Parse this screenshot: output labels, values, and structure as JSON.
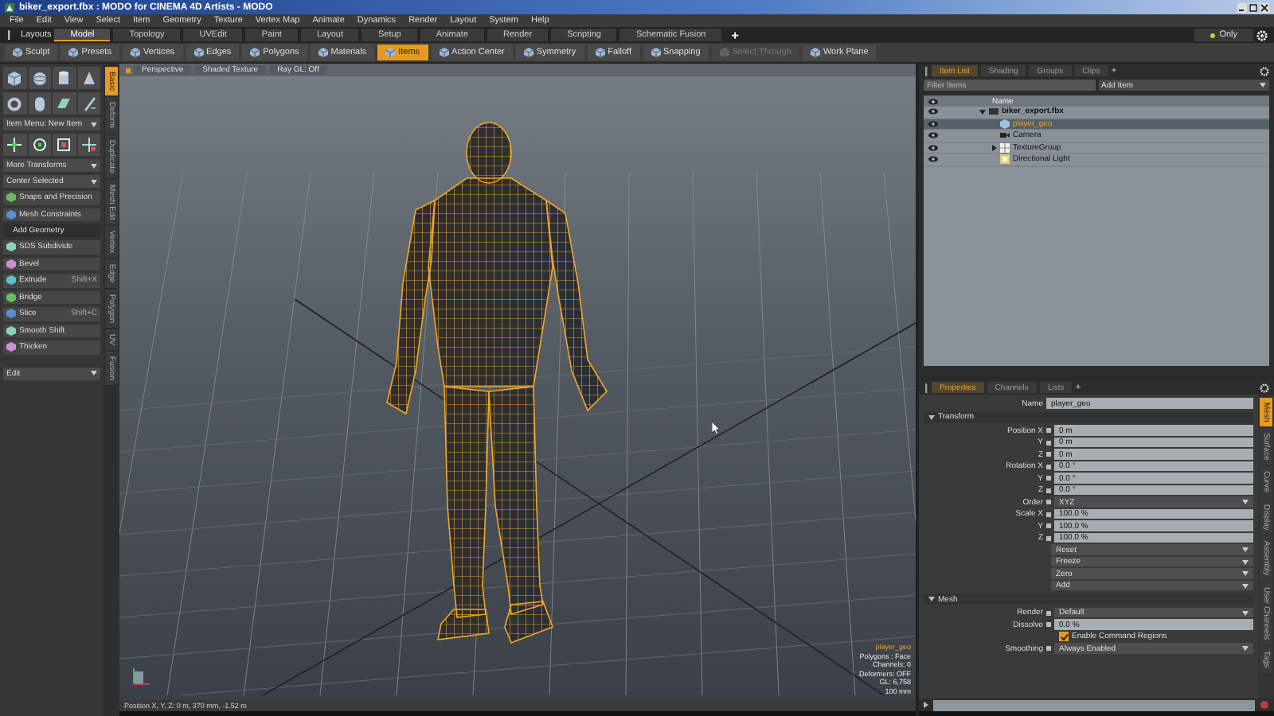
{
  "window": {
    "title": "biker_export.fbx : MODO for CINEMA 4D Artists - MODO"
  },
  "menu": [
    "File",
    "Edit",
    "View",
    "Select",
    "Item",
    "Geometry",
    "Texture",
    "Vertex Map",
    "Animate",
    "Dynamics",
    "Render",
    "Layout",
    "System",
    "Help"
  ],
  "layouts_bar": {
    "label": "Layouts",
    "tabs": [
      {
        "label": "Model",
        "selected": true
      },
      {
        "label": "Topology",
        "selected": false
      },
      {
        "label": "UVEdit",
        "selected": false
      },
      {
        "label": "Paint",
        "selected": false
      },
      {
        "label": "Layout",
        "selected": false
      },
      {
        "label": "Setup",
        "selected": false
      },
      {
        "label": "Animate",
        "selected": false
      },
      {
        "label": "Render",
        "selected": false
      },
      {
        "label": "Scripting",
        "selected": false
      },
      {
        "label": "Schematic Fusion",
        "selected": false
      }
    ],
    "add": "+",
    "filter": "Only"
  },
  "toolbar": [
    {
      "label": "Sculpt",
      "selected": false,
      "disabled": false
    },
    {
      "label": "Presets",
      "selected": false,
      "disabled": false
    },
    {
      "label": "Vertices",
      "selected": false,
      "disabled": false
    },
    {
      "label": "Edges",
      "selected": false,
      "disabled": false
    },
    {
      "label": "Polygons",
      "selected": false,
      "disabled": false
    },
    {
      "label": "Materials",
      "selected": false,
      "disabled": false
    },
    {
      "label": "Items",
      "selected": true,
      "disabled": false
    },
    {
      "label": "Action Center",
      "selected": false,
      "disabled": false
    },
    {
      "label": "Symmetry",
      "selected": false,
      "disabled": false
    },
    {
      "label": "Falloff",
      "selected": false,
      "disabled": false
    },
    {
      "label": "Snapping",
      "selected": false,
      "disabled": false
    },
    {
      "label": "Select Through",
      "selected": false,
      "disabled": true
    },
    {
      "label": "Work Plane",
      "selected": false,
      "disabled": false
    }
  ],
  "left_panel": [
    {
      "kind": "primitives"
    },
    {
      "kind": "shapes"
    },
    {
      "kind": "dropdown",
      "label": "Item Menu: New Item"
    },
    {
      "kind": "transforms"
    },
    {
      "kind": "dropdown",
      "label": "More Transforms"
    },
    {
      "kind": "dropdown",
      "label": "Center Selected"
    },
    {
      "kind": "tool",
      "label": "Snaps and Precision"
    },
    {
      "kind": "tool",
      "label": "Mesh Constraints"
    },
    {
      "kind": "header",
      "label": "Add Geometry"
    },
    {
      "kind": "tool",
      "label": "SDS Subdivide"
    },
    {
      "kind": "tool",
      "label": "Bevel"
    },
    {
      "kind": "tool",
      "label": "Extrude",
      "shortcut": "Shift+X"
    },
    {
      "kind": "tool",
      "label": "Bridge"
    },
    {
      "kind": "tool",
      "label": "Slice",
      "shortcut": "Shift+C"
    },
    {
      "kind": "tool",
      "label": "Smooth Shift"
    },
    {
      "kind": "tool",
      "label": "Thicken"
    },
    {
      "kind": "dropdown",
      "label": "Edit"
    }
  ],
  "tool_tabs": [
    {
      "label": "Basic",
      "selected": true
    },
    {
      "label": "Deform",
      "selected": false
    },
    {
      "label": "Duplicate",
      "selected": false
    },
    {
      "label": "Mesh Edit",
      "selected": false
    },
    {
      "label": "Vertex",
      "selected": false
    },
    {
      "label": "Edge",
      "selected": false
    },
    {
      "label": "Polygon",
      "selected": false
    },
    {
      "label": "UV",
      "selected": false
    },
    {
      "label": "Fusion",
      "selected": false
    }
  ],
  "viewport": {
    "tabs": [
      "Perspective",
      "Shaded Texture",
      "Ray GL: Off"
    ],
    "info": {
      "selection": "player_geo",
      "lines": [
        "Polygons : Face",
        "Channels: 0",
        "Deformers: OFF",
        "GL: 6,758",
        "100 mm"
      ]
    },
    "status": "Position X, Y, Z:  0 m, 370 mm, -1.52 m"
  },
  "item_list": {
    "tabs": [
      {
        "label": "Item List",
        "selected": true
      },
      {
        "label": "Shading",
        "selected": false
      },
      {
        "label": "Groups",
        "selected": false
      },
      {
        "label": "Clips",
        "selected": false
      }
    ],
    "add_tab": "+",
    "filter_placeholder": "Filter Items",
    "add_item": "Add Item",
    "name_column": "Name",
    "items": [
      {
        "name": "biker_export.fbx",
        "kind": "scene",
        "selected": false,
        "expanded": true,
        "children": [
          {
            "name": "player_geo",
            "kind": "mesh",
            "selected": true
          },
          {
            "name": "Camera",
            "kind": "camera",
            "selected": false
          },
          {
            "name": "TextureGroup",
            "kind": "group",
            "selected": false,
            "expanded": false
          },
          {
            "name": "Directional Light",
            "kind": "light",
            "selected": false
          }
        ]
      }
    ]
  },
  "properties": {
    "tabs": [
      {
        "label": "Properties",
        "selected": true
      },
      {
        "label": "Channels",
        "selected": false
      },
      {
        "label": "Lists",
        "selected": false
      }
    ],
    "add_tab": "+",
    "name_label": "Name",
    "name_value": "player_geo",
    "sections": [
      {
        "title": "Transform",
        "rows": [
          {
            "kind": "field",
            "label": "Position X",
            "value": "0 m"
          },
          {
            "kind": "field",
            "label": "Y",
            "value": "0 m"
          },
          {
            "kind": "field",
            "label": "Z",
            "value": "0 m"
          },
          {
            "kind": "field",
            "label": "Rotation X",
            "value": "0.0 °"
          },
          {
            "kind": "field",
            "label": "Y",
            "value": "0.0 °"
          },
          {
            "kind": "field",
            "label": "Z",
            "value": "0.0 °"
          },
          {
            "kind": "dropdown",
            "label": "Order",
            "value": "XYZ"
          },
          {
            "kind": "field",
            "label": "Scale X",
            "value": "100.0 %"
          },
          {
            "kind": "field",
            "label": "Y",
            "value": "100.0 %"
          },
          {
            "kind": "field",
            "label": "Z",
            "value": "100.0 %"
          },
          {
            "kind": "button",
            "value": "Reset"
          },
          {
            "kind": "button",
            "value": "Freeze"
          },
          {
            "kind": "button",
            "value": "Zero"
          },
          {
            "kind": "button",
            "value": "Add"
          }
        ]
      },
      {
        "title": "Mesh",
        "rows": [
          {
            "kind": "dropdown",
            "label": "Render",
            "value": "Default"
          },
          {
            "kind": "field",
            "label": "Dissolve",
            "value": "0.0 %"
          },
          {
            "kind": "checkbox",
            "value": "Enable Command Regions",
            "checked": true
          },
          {
            "kind": "dropdown",
            "label": "Smoothing",
            "value": "Always Enabled"
          }
        ]
      }
    ],
    "side_tabs": [
      {
        "label": "Mesh",
        "selected": true
      },
      {
        "label": "Surface",
        "selected": false
      },
      {
        "label": "Curve",
        "selected": false
      },
      {
        "label": "Display",
        "selected": false
      },
      {
        "label": "Assembly",
        "selected": false
      },
      {
        "label": "User Channels",
        "selected": false
      },
      {
        "label": "Tags",
        "selected": false
      }
    ]
  }
}
